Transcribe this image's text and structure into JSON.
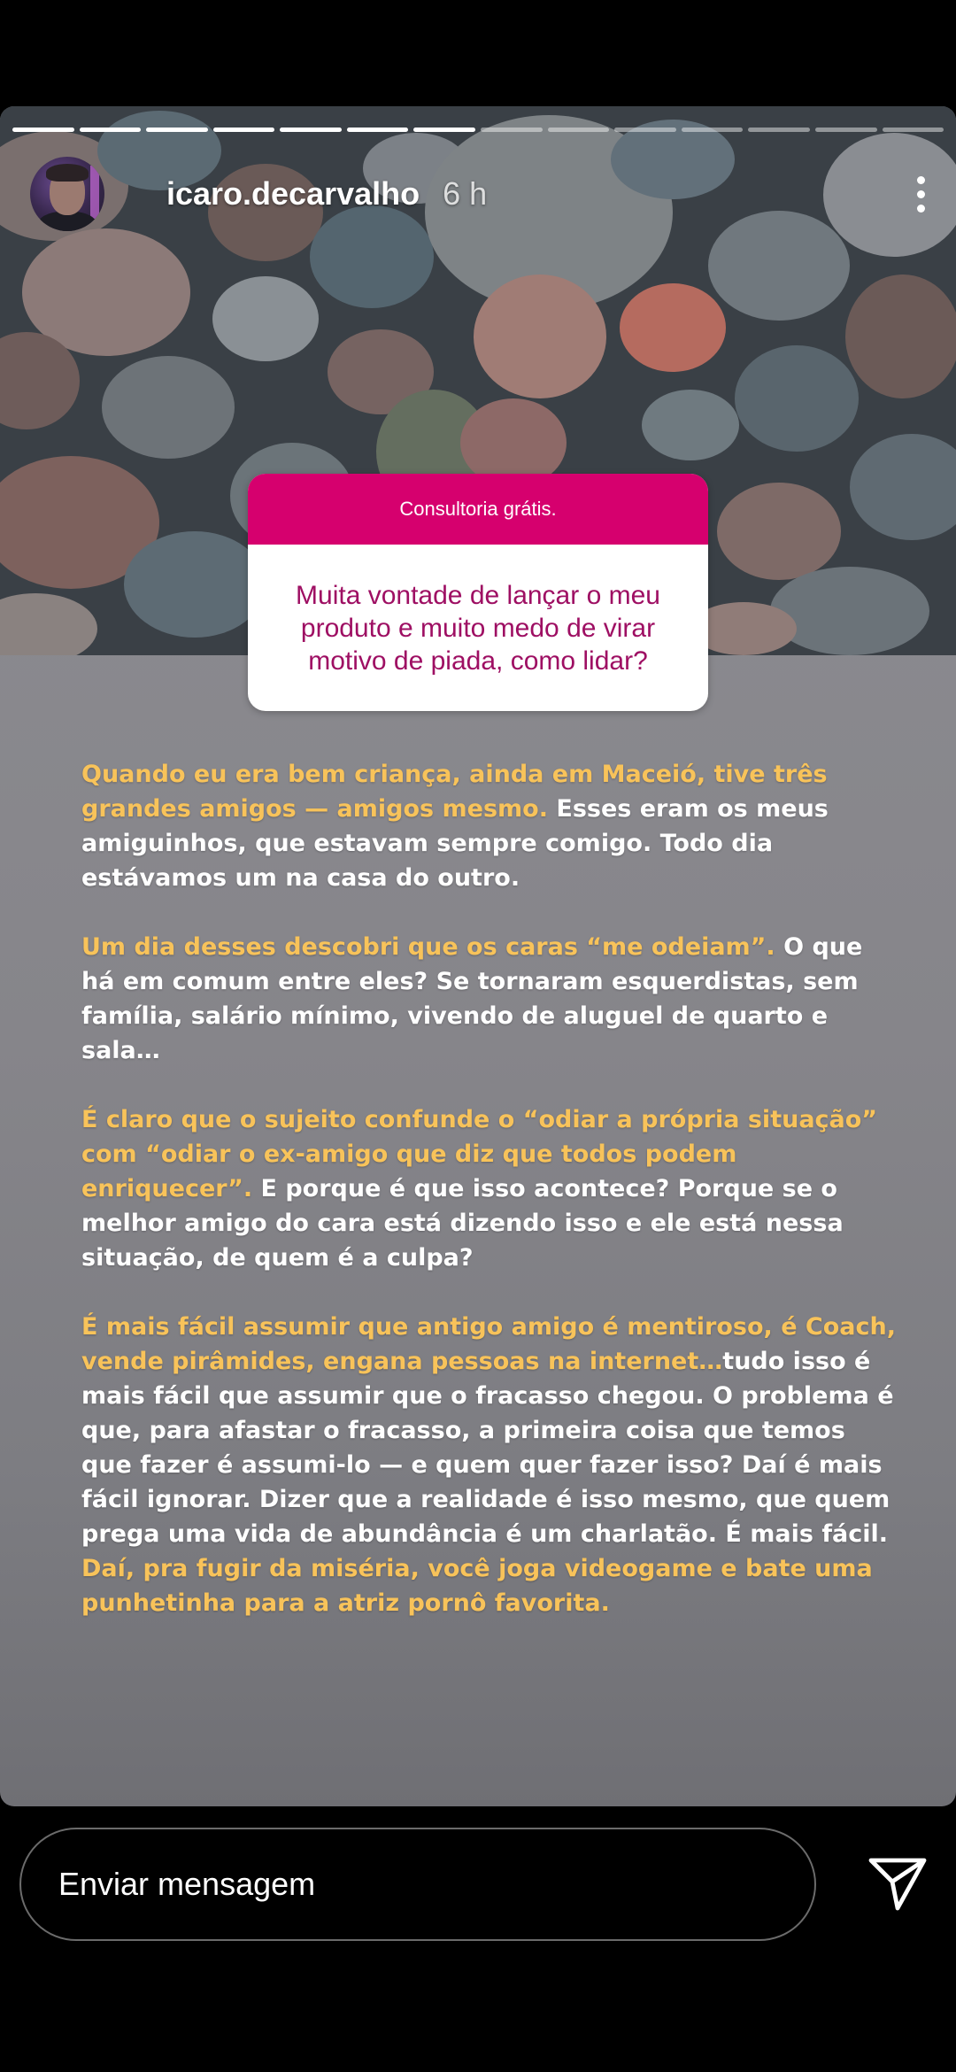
{
  "story": {
    "progress": {
      "segments": 14,
      "current": 7
    },
    "user": {
      "username": "icaro.decarvalho",
      "time": "6 h"
    },
    "question_box": {
      "header": "Consultoria grátis.",
      "question": "Muita vontade de lançar o meu produto e muito medo de virar motivo de piada, como lidar?"
    },
    "body": {
      "p1": {
        "highlight": "Quando eu era bem criança, ainda em Maceió, tive três grandes amigos — amigos mesmo.",
        "text": " Esses eram os meus amiguinhos, que estavam sempre comigo. Todo dia estávamos um na casa do outro."
      },
      "p2": {
        "highlight": "Um dia desses descobri que os caras “me odeiam”.",
        "text": " O que há em comum entre eles? Se tornaram esquerdistas, sem família, salário mínimo, vivendo de aluguel de quarto e sala…"
      },
      "p3": {
        "highlight": "É claro que o sujeito confunde o “odiar a própria situação” com “odiar o ex-amigo que diz que todos podem enriquecer”.",
        "text": " E porque é que isso acontece? Porque se o melhor amigo do cara está dizendo isso e ele está nessa situação, de quem é a culpa?"
      },
      "p4": {
        "highlight": "É mais fácil assumir que antigo amigo é mentiroso, é Coach, vende pirâmides, engana pessoas na internet…",
        "text": "tudo isso é mais fácil que assumir que o fracasso chegou. O problema é que, para afastar o fracasso, a primeira coisa que temos que fazer é assumi-lo — e quem quer fazer isso? Daí é mais fácil ignorar. Dizer que a realidade é isso mesmo, que quem prega uma vida de abundância é um charlatão. É mais fácil. ",
        "highlight2": "Daí, pra fugir da miséria, você joga videogame e bate uma punhetinha para a atriz pornô favorita."
      }
    },
    "colors": {
      "highlight": "#f8c35a",
      "question_header": "#d6006e",
      "question_text": "#9e0f63"
    }
  },
  "footer": {
    "message_placeholder": "Enviar mensagem",
    "send_icon": "paper-plane-icon"
  }
}
